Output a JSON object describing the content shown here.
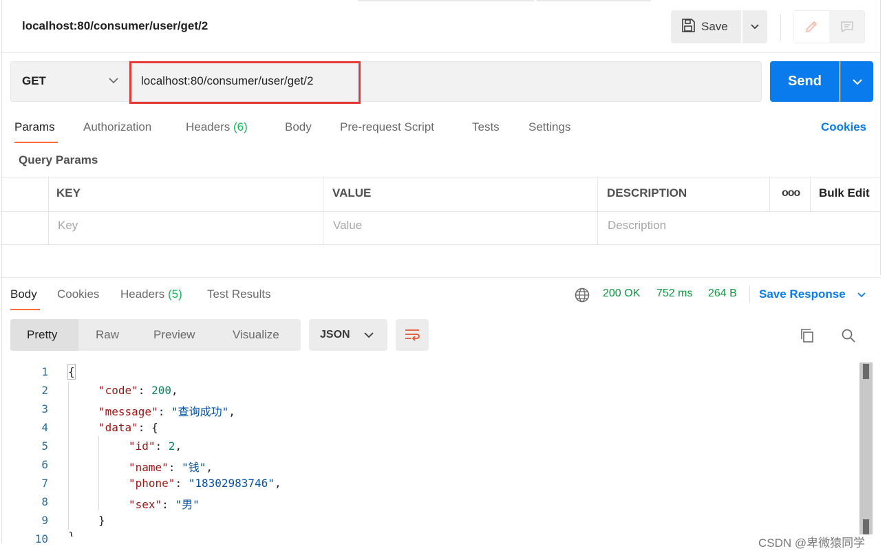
{
  "request": {
    "title": "localhost:80/consumer/user/get/2",
    "save_label": "Save",
    "method": "GET",
    "url": "localhost:80/consumer/user/get/2",
    "send_label": "Send"
  },
  "request_tabs": [
    {
      "label": "Params",
      "count": ""
    },
    {
      "label": "Authorization",
      "count": ""
    },
    {
      "label": "Headers ",
      "count": "(6)"
    },
    {
      "label": "Body",
      "count": ""
    },
    {
      "label": "Pre-request Script",
      "count": ""
    },
    {
      "label": "Tests",
      "count": ""
    },
    {
      "label": "Settings",
      "count": ""
    }
  ],
  "cookies_label": "Cookies",
  "query_params": {
    "title": "Query Params",
    "headers": {
      "key": "KEY",
      "value": "VALUE",
      "description": "DESCRIPTION",
      "bulk_edit": "Bulk Edit",
      "more": "ooo"
    },
    "placeholders": {
      "key": "Key",
      "value": "Value",
      "description": "Description"
    }
  },
  "response_tabs": [
    {
      "label": "Body",
      "count": ""
    },
    {
      "label": "Cookies",
      "count": ""
    },
    {
      "label": "Headers ",
      "count": "(5)"
    },
    {
      "label": "Test Results",
      "count": ""
    }
  ],
  "response_status": {
    "status": "200 OK",
    "time": "752 ms",
    "size": "264 B"
  },
  "save_response_label": "Save Response",
  "format_tabs": [
    "Pretty",
    "Raw",
    "Preview",
    "Visualize"
  ],
  "format_language": "JSON",
  "code_lines": [
    {
      "n": "1",
      "text": "{"
    },
    {
      "n": "2",
      "key": "\"code\"",
      "val": "200",
      "val_type": "n",
      "tail": ","
    },
    {
      "n": "3",
      "key": "\"message\"",
      "val": "\"查询成功\"",
      "val_type": "s",
      "tail": ","
    },
    {
      "n": "4",
      "key": "\"data\"",
      "val": "{",
      "val_type": "p",
      "tail": ""
    },
    {
      "n": "5",
      "key": "\"id\"",
      "val": "2",
      "val_type": "n",
      "tail": ","
    },
    {
      "n": "6",
      "key": "\"name\"",
      "val": "\"钱\"",
      "val_type": "s",
      "tail": ","
    },
    {
      "n": "7",
      "key": "\"phone\"",
      "val": "\"18302983746\"",
      "val_type": "s",
      "tail": ","
    },
    {
      "n": "8",
      "key": "\"sex\"",
      "val": "\"男\"",
      "val_type": "s",
      "tail": ""
    },
    {
      "n": "9",
      "text": "}"
    },
    {
      "n": "10",
      "text": "}"
    }
  ],
  "watermark": "CSDN @卑微猿同学",
  "colors": {
    "accent": "#097bed",
    "tab_underline": "#ff6c37",
    "status_ok": "#0c9a3d",
    "highlight_box": "#e53935"
  }
}
